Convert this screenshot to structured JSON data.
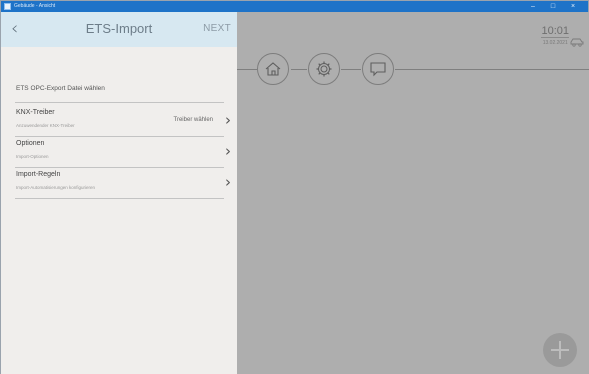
{
  "window": {
    "title": "Gebäude - Ansicht",
    "controls": {
      "minimize": "–",
      "maximize": "□",
      "close": "×"
    }
  },
  "header": {
    "back_icon": "chevron-left-icon",
    "title": "ETS-Import",
    "next_label": "NEXT"
  },
  "content": {
    "section_label": "ETS OPC-Export Datei wählen",
    "rows": [
      {
        "title": "KNX-Treiber",
        "subtitle": "Anzuwendender KNX-Treiber",
        "value": "Treiber wählen"
      },
      {
        "title": "Optionen",
        "subtitle": "Import-Optionen",
        "value": ""
      },
      {
        "title": "Import-Regeln",
        "subtitle": "Import-Automatisierungen konfigurieren",
        "value": ""
      }
    ]
  },
  "right": {
    "nav": [
      "home-icon",
      "gear-icon",
      "chat-icon"
    ],
    "time": "10:01",
    "date": "13.02.2021",
    "add_button_icon": "plus-icon"
  },
  "colors": {
    "titlebar": "#1e73c8",
    "header_bg": "#d7e8f1",
    "left_bg": "#f0eeec",
    "right_bg": "#aeaeae"
  }
}
